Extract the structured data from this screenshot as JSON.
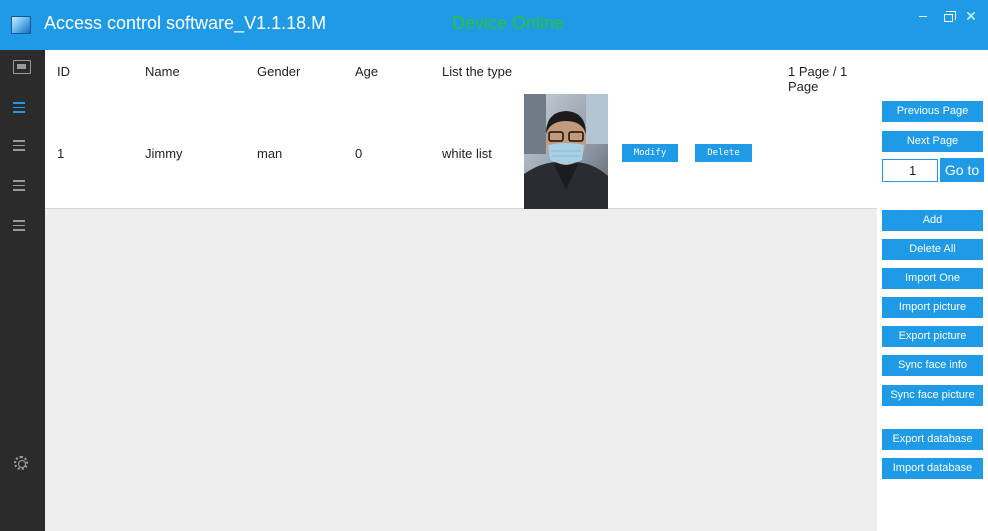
{
  "window": {
    "title": "Access control software_V1.1.18.M",
    "device_status": "Device Online",
    "close_glyph": "✕"
  },
  "colors": {
    "accent": "#1e9ae6",
    "status_green": "#27c43a",
    "sidebar_bg": "#2b2b2b",
    "sidebar_active": "#1e9ae6",
    "sidebar_icon": "#9a9a9a"
  },
  "sidebar": {
    "items": [
      {
        "icon": "monitor-icon",
        "active": false
      },
      {
        "icon": "list-icon",
        "active": true
      },
      {
        "icon": "list-icon",
        "active": false
      },
      {
        "icon": "list-icon",
        "active": false
      },
      {
        "icon": "list-icon",
        "active": false
      }
    ],
    "settings_icon": "gear-icon"
  },
  "table": {
    "columns": [
      "ID",
      "Name",
      "Gender",
      "Age",
      "List the type"
    ],
    "page_info": "1 Page / 1 Page",
    "rows": [
      {
        "id": "1",
        "name": "Jimmy",
        "gender": "man",
        "age": "0",
        "list_type": "white list",
        "modify_label": "Modify",
        "delete_label": "Delete"
      }
    ]
  },
  "pagination": {
    "previous_label": "Previous Page",
    "next_label": "Next Page",
    "page_value": "1",
    "goto_label": "Go to"
  },
  "actions": {
    "add": "Add",
    "delete_all": "Delete All",
    "import_one": "Import One",
    "import_picture": "Import picture",
    "export_picture": "Export picture",
    "sync_face_info": "Sync face info",
    "sync_face_picture": "Sync face picture",
    "export_database": "Export database",
    "import_database": "Import database"
  }
}
